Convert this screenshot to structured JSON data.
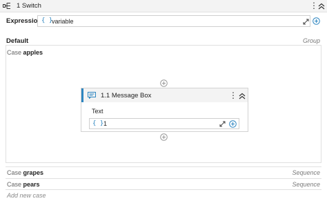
{
  "header": {
    "title": "1 Switch"
  },
  "expression": {
    "label": "Expression",
    "brace": "{ }",
    "value": "variable"
  },
  "default": {
    "label": "Default",
    "group_label": "Group"
  },
  "cases": {
    "apples": {
      "keyword": "Case",
      "name": "apples"
    },
    "grapes": {
      "keyword": "Case",
      "name": "grapes",
      "type": "Sequence"
    },
    "pears": {
      "keyword": "Case",
      "name": "pears",
      "type": "Sequence"
    }
  },
  "message_box": {
    "title": "1.1 Message Box",
    "text_label": "Text",
    "brace": "{ }",
    "text_value": "1"
  },
  "add_case": {
    "label": "Add new case"
  },
  "icons": [
    "switch-icon",
    "kebab-menu-icon",
    "collapse-icon",
    "expand-icon",
    "plus-circle-icon",
    "message-box-icon"
  ],
  "colors": {
    "accent": "#2e86c1",
    "header_bg": "#f3f3f3",
    "border": "#e0e0e0"
  }
}
